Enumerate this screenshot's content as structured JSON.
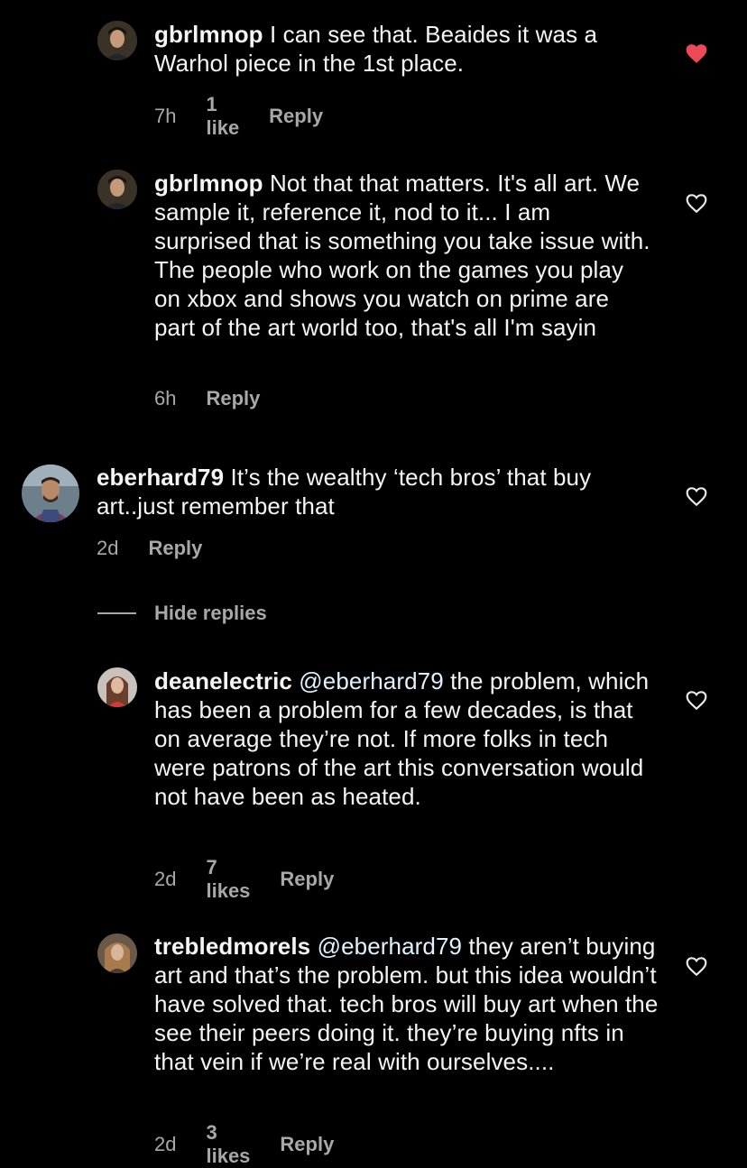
{
  "comments": [
    {
      "username": "gbrlmnop",
      "text": "I can see that. Beaides it was a Warhol piece in the 1st place.",
      "time": "7h",
      "likes": "1 like",
      "reply": "Reply",
      "liked": true,
      "avatar_colors": {
        "bg": "#3a3226",
        "face": "#c49a7a",
        "hair": "#1a140e"
      }
    },
    {
      "username": "gbrlmnop",
      "text": "Not that that matters. It's all art. We sample it, reference it, nod to it... I am surprised that is something you take issue with. The people who work on the games you play on xbox and shows you watch on prime are part of the art world too, that's all I'm sayin",
      "time": "6h",
      "reply": "Reply",
      "liked": false,
      "avatar_colors": {
        "bg": "#3a3226",
        "face": "#c49a7a",
        "hair": "#1a140e"
      }
    },
    {
      "username": "eberhard79",
      "text": "It’s the wealthy ‘tech bros’ that buy art..just remember that",
      "time": "2d",
      "reply": "Reply",
      "liked": false,
      "avatar_colors": {
        "bg": "#6e7f8c",
        "face": "#b88a6a",
        "hair": "#2b1e15"
      }
    },
    {
      "username": "deanelectric",
      "mention": "@eberhard79",
      "text": "the problem, which has been a problem for a few decades, is that on average they’re not. If more folks in tech were patrons of the art this conversation would not have been as heated.",
      "time": "2d",
      "likes": "7 likes",
      "reply": "Reply",
      "liked": false,
      "avatar_colors": {
        "bg": "#c9c2bc",
        "face": "#e0b9a0",
        "hair": "#6b3f2a"
      }
    },
    {
      "username": "trebledmorels",
      "mention": "@eberhard79",
      "text": " they aren’t buying art and that’s the problem. but this idea wouldn’t have solved that. tech bros will buy art when the see their peers doing it. they’re buying nfts in that vein if we’re real with ourselves....",
      "time": "2d",
      "likes": "3 likes",
      "reply": "Reply",
      "liked": false,
      "avatar_colors": {
        "bg": "#6a5848",
        "face": "#d8b69a",
        "hair": "#a87a4e"
      }
    }
  ],
  "hide_replies": "Hide replies",
  "colors": {
    "background": "#000000",
    "text": "#f5f5f5",
    "muted": "#a8a8a8",
    "like_red": "#ed4956",
    "mention": "#e0f1ff"
  }
}
